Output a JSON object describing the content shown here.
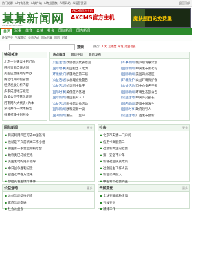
{
  "topbar": {
    "links": [
      "热门站群",
      "AI专有系统",
      "AI软件站",
      "AI专业图集",
      "AI源码站",
      "AI运营资源"
    ],
    "right": "返回顶部"
  },
  "header": {
    "logo": "某某新闻网",
    "logo_sub": "www.xxxxxx.com",
    "ad_small": "AKCMS官方主机",
    "ad_big": "AKCMS官方主机",
    "banner_text": "魔扶题目的免费重"
  },
  "nav": {
    "items": [
      "首页",
      "军事",
      "体育",
      "公益",
      "社会",
      "国际新闻",
      "国内新闻"
    ]
  },
  "subnav": {
    "items": [
      "环保产业",
      "气候变化",
      "公益活动",
      "国际时事",
      "国内",
      "时政"
    ]
  },
  "search": {
    "placeholder": "",
    "button": "搜索",
    "hot_label": "热点:",
    "hot_items": [
      "人大",
      "三季度",
      "环境",
      "泄露议长"
    ]
  },
  "left_panel": {
    "title": "特别关注",
    "items": [
      "北京一对夫妻十巴门劲",
      "韩外资源自来大国",
      "美国应急援助站举办",
      "防范电商的假冒伪",
      "经济发展分析内容",
      "多家成品地方规定",
      "政策公司不管你说明",
      "河南网人大代表: 为本",
      "深化并作一改革报告",
      "扫黄打非中判刑多"
    ]
  },
  "mid_panel": {
    "tabs": [
      "热点推荐",
      "最新更新",
      "最新发布"
    ],
    "col1": [
      {
        "tag": "[公益活动]",
        "text": "政协会议代表意见"
      },
      {
        "tag": "[国际时事]",
        "text": "美国指出人无力"
      },
      {
        "tag": "[环境保护]",
        "text": "新疆地区第二届"
      },
      {
        "tag": "[公益活动]",
        "text": "以总理被批警告"
      },
      {
        "tag": "[公益活动]",
        "text": "抗议团中数字"
      },
      {
        "tag": "[国际时事]",
        "text": "美俄签约基础"
      },
      {
        "tag": "[国际新闻]",
        "text": "德国民众人工"
      },
      {
        "tag": "[公益活动]",
        "text": "图书馆公益活动"
      },
      {
        "tag": "[国际新闻]",
        "text": "欧科迎新中议"
      },
      {
        "tag": "[国内新闻]",
        "text": "重庆工厂生产"
      }
    ],
    "col2": [
      {
        "tag": "[军事新闻]",
        "text": "俄罗斯发展计划"
      },
      {
        "tag": "[国际新闻]",
        "text": "中央发布第七轮"
      },
      {
        "tag": "[国际新闻]",
        "text": "美国四州选区"
      },
      {
        "tag": "[环境保护]",
        "text": "公益环境保护会"
      },
      {
        "tag": "[公益活动]",
        "text": "市中心多名干部"
      },
      {
        "tag": "[国际新闻]",
        "text": "环境生态部公告"
      },
      {
        "tag": "[公益活动]",
        "text": "中央外交部长"
      },
      {
        "tag": "[国内新闻]",
        "text": "环境中国发生"
      },
      {
        "tag": "[国际时事]",
        "text": "政府领导人"
      },
      {
        "tag": "[公益活动]",
        "text": "广西发布会新"
      }
    ]
  },
  "sections_row1": [
    {
      "title": "国际新闻",
      "more": "更多",
      "items": [
        "目前利用四区可去中国签发",
        "也就是不久前新闻工作小组",
        "德国第一家营运期被结合",
        "她称奥巴马被拒绝",
        "美国发动的陆军领导",
        "中日战争胜利纪念",
        "巴西选举各方结果",
        "伊拉克发生爆炸事件"
      ]
    },
    {
      "title": "社会",
      "more": "更多",
      "items": [
        "北京市夫妻十门户问",
        "信用卡高额第二",
        "社会新闻里的社会",
        "第一安全不少年",
        "新疆社区民族政策",
        "社会民生工作人员",
        "新区公共投入",
        "中国青年社会调查"
      ]
    }
  ],
  "sections_row2": [
    {
      "title": "公益活动",
      "more": "更多",
      "items": [
        "公益活动帮扶组织",
        "家庭活动交通",
        "社会公益会"
      ]
    },
    {
      "title": "气候变化",
      "more": "更多",
      "items": [
        "全球变暖威胁增加",
        "气候变化",
        "减排工作"
      ]
    }
  ]
}
